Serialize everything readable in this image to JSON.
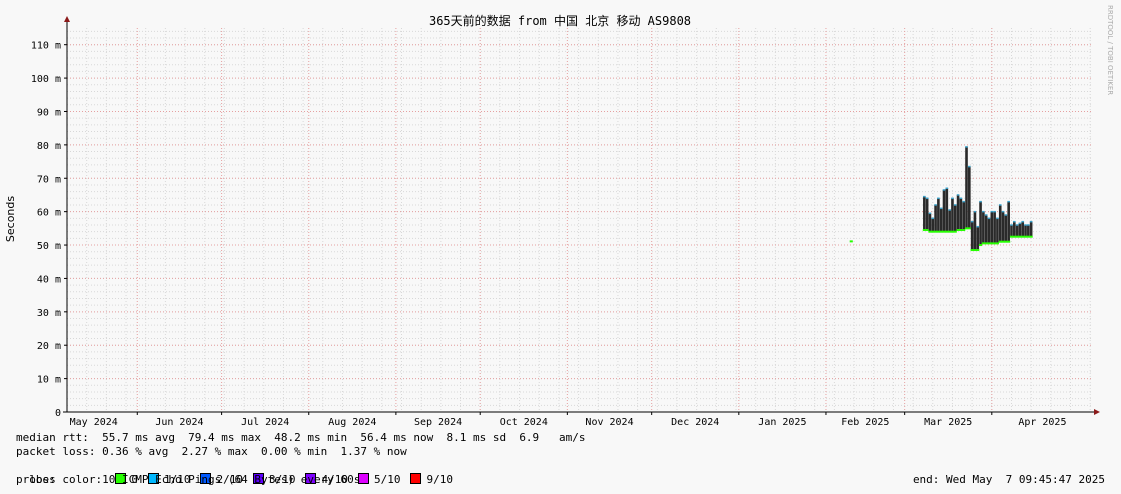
{
  "chart_data": {
    "type": "line",
    "title": "365天前的数据 from 中国 北京 移动 AS9808",
    "ylabel": "Seconds",
    "watermark": "RRDTOOL / TOBI OETIKER",
    "ylim": [
      0,
      0.115
    ],
    "yticks": [
      {
        "v": 0,
        "label": "0"
      },
      {
        "v": 0.01,
        "label": "10 m"
      },
      {
        "v": 0.02,
        "label": "20 m"
      },
      {
        "v": 0.03,
        "label": "30 m"
      },
      {
        "v": 0.04,
        "label": "40 m"
      },
      {
        "v": 0.05,
        "label": "50 m"
      },
      {
        "v": 0.06,
        "label": "60 m"
      },
      {
        "v": 0.07,
        "label": "70 m"
      },
      {
        "v": 0.08,
        "label": "80 m"
      },
      {
        "v": 0.09,
        "label": "90 m"
      },
      {
        "v": 0.1,
        "label": "100 m"
      },
      {
        "v": 0.11,
        "label": "110 m"
      }
    ],
    "xrange": [
      "2024-05-07",
      "2025-05-07"
    ],
    "xticks": [
      {
        "date": "2024-05-01",
        "label": "May 2024"
      },
      {
        "date": "2024-06-01",
        "label": "Jun 2024"
      },
      {
        "date": "2024-07-01",
        "label": "Jul 2024"
      },
      {
        "date": "2024-08-01",
        "label": "Aug 2024"
      },
      {
        "date": "2024-09-01",
        "label": "Sep 2024"
      },
      {
        "date": "2024-10-01",
        "label": "Oct 2024"
      },
      {
        "date": "2024-11-01",
        "label": "Nov 2024"
      },
      {
        "date": "2024-12-01",
        "label": "Dec 2024"
      },
      {
        "date": "2025-01-01",
        "label": "Jan 2025"
      },
      {
        "date": "2025-02-01",
        "label": "Feb 2025"
      },
      {
        "date": "2025-03-01",
        "label": "Mar 2025"
      },
      {
        "date": "2025-04-01",
        "label": "Apr 2025"
      }
    ],
    "grid": true,
    "series": [
      {
        "name": "median rtt",
        "points": [
          {
            "date": "2025-02-10",
            "median": 0.0511,
            "max": 0.0511
          },
          {
            "date": "2025-03-08",
            "median": 0.0545,
            "max": 0.0645
          },
          {
            "date": "2025-03-09",
            "median": 0.0545,
            "max": 0.064
          },
          {
            "date": "2025-03-10",
            "median": 0.054,
            "max": 0.0595
          },
          {
            "date": "2025-03-11",
            "median": 0.054,
            "max": 0.058
          },
          {
            "date": "2025-03-12",
            "median": 0.054,
            "max": 0.062
          },
          {
            "date": "2025-03-13",
            "median": 0.054,
            "max": 0.064
          },
          {
            "date": "2025-03-14",
            "median": 0.054,
            "max": 0.061
          },
          {
            "date": "2025-03-15",
            "median": 0.054,
            "max": 0.0665
          },
          {
            "date": "2025-03-16",
            "median": 0.054,
            "max": 0.067
          },
          {
            "date": "2025-03-17",
            "median": 0.054,
            "max": 0.0605
          },
          {
            "date": "2025-03-18",
            "median": 0.054,
            "max": 0.064
          },
          {
            "date": "2025-03-19",
            "median": 0.054,
            "max": 0.062
          },
          {
            "date": "2025-03-20",
            "median": 0.0545,
            "max": 0.065
          },
          {
            "date": "2025-03-21",
            "median": 0.0545,
            "max": 0.064
          },
          {
            "date": "2025-03-22",
            "median": 0.0545,
            "max": 0.063
          },
          {
            "date": "2025-03-23",
            "median": 0.055,
            "max": 0.0794
          },
          {
            "date": "2025-03-24",
            "median": 0.055,
            "max": 0.0735
          },
          {
            "date": "2025-03-25",
            "median": 0.0485,
            "max": 0.057
          },
          {
            "date": "2025-03-26",
            "median": 0.0485,
            "max": 0.06
          },
          {
            "date": "2025-03-27",
            "median": 0.0485,
            "max": 0.0555
          },
          {
            "date": "2025-03-28",
            "median": 0.05,
            "max": 0.063
          },
          {
            "date": "2025-03-29",
            "median": 0.0505,
            "max": 0.06
          },
          {
            "date": "2025-03-30",
            "median": 0.0505,
            "max": 0.059
          },
          {
            "date": "2025-03-31",
            "median": 0.0505,
            "max": 0.058
          },
          {
            "date": "2025-04-01",
            "median": 0.0505,
            "max": 0.06
          },
          {
            "date": "2025-04-02",
            "median": 0.0505,
            "max": 0.06
          },
          {
            "date": "2025-04-03",
            "median": 0.0505,
            "max": 0.058
          },
          {
            "date": "2025-04-04",
            "median": 0.051,
            "max": 0.062
          },
          {
            "date": "2025-04-05",
            "median": 0.051,
            "max": 0.06
          },
          {
            "date": "2025-04-06",
            "median": 0.051,
            "max": 0.059
          },
          {
            "date": "2025-04-07",
            "median": 0.051,
            "max": 0.063
          },
          {
            "date": "2025-04-08",
            "median": 0.0525,
            "max": 0.056
          },
          {
            "date": "2025-04-09",
            "median": 0.0525,
            "max": 0.057
          },
          {
            "date": "2025-04-10",
            "median": 0.0525,
            "max": 0.056
          },
          {
            "date": "2025-04-11",
            "median": 0.0525,
            "max": 0.0565
          },
          {
            "date": "2025-04-12",
            "median": 0.0525,
            "max": 0.057
          },
          {
            "date": "2025-04-13",
            "median": 0.0525,
            "max": 0.056
          },
          {
            "date": "2025-04-14",
            "median": 0.0525,
            "max": 0.056
          },
          {
            "date": "2025-04-15",
            "median": 0.0525,
            "max": 0.057
          }
        ]
      }
    ]
  },
  "stats": {
    "median_rtt": "median rtt:  55.7 ms avg  79.4 ms max  48.2 ms min  56.4 ms now  8.1 ms sd  6.9   am/s",
    "packet_loss": "packet loss: 0.36 % avg  2.27 % max  0.00 % min  1.37 % now",
    "loss_color_label": "loss color:",
    "loss_colors": [
      {
        "label": "0",
        "color": "#26ff00"
      },
      {
        "label": "1/10",
        "color": "#00b8ff"
      },
      {
        "label": "2/10",
        "color": "#0059ff"
      },
      {
        "label": "3/10",
        "color": "#5e00ff"
      },
      {
        "label": "4/10",
        "color": "#7e00ff"
      },
      {
        "label": "5/10",
        "color": "#dd00ff"
      },
      {
        "label": "9/10",
        "color": "#ff0000"
      }
    ],
    "probe": "probe:       10 ICMP Echo Pings (64 Bytes) every 60s",
    "end": "end: Wed May  7 09:45:47 2025"
  }
}
